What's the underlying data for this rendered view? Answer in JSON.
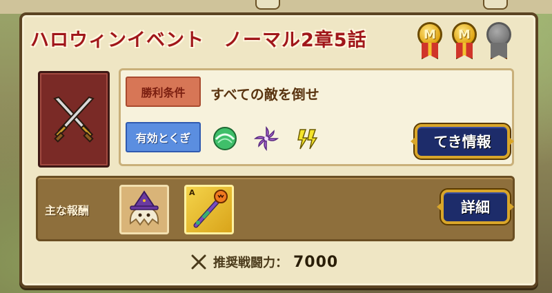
{
  "stage": {
    "title": "ハロウィンイベント　ノーマル2章5話",
    "medals": [
      {
        "letter": "M",
        "earned": true
      },
      {
        "letter": "M",
        "earned": true
      },
      {
        "letter": "",
        "earned": false
      }
    ]
  },
  "conditions": {
    "win_tag": "勝利条件",
    "win_text": "すべての敵を倒せ",
    "effective_tag": "有効とくぎ",
    "effective_icons": [
      "green-spin-skill-icon",
      "purple-vortex-skill-icon",
      "yellow-lightning-skill-icon"
    ]
  },
  "buttons": {
    "enemy_info": "てき情報",
    "details": "詳細"
  },
  "rewards": {
    "label": "主な報酬",
    "items": [
      {
        "icon": "ghost-witch-cookie-icon"
      },
      {
        "icon": "halloween-staff-icon",
        "rank": "A"
      }
    ]
  },
  "recommended": {
    "label": "推奨戦闘力：",
    "value": "7000"
  },
  "colors": {
    "title_red": "#a0161a",
    "win_tag_bg": "#d77656",
    "effective_tag_bg": "#5b8ee0",
    "button_bg": "#1d2c6a",
    "button_border": "#d9a62a"
  }
}
